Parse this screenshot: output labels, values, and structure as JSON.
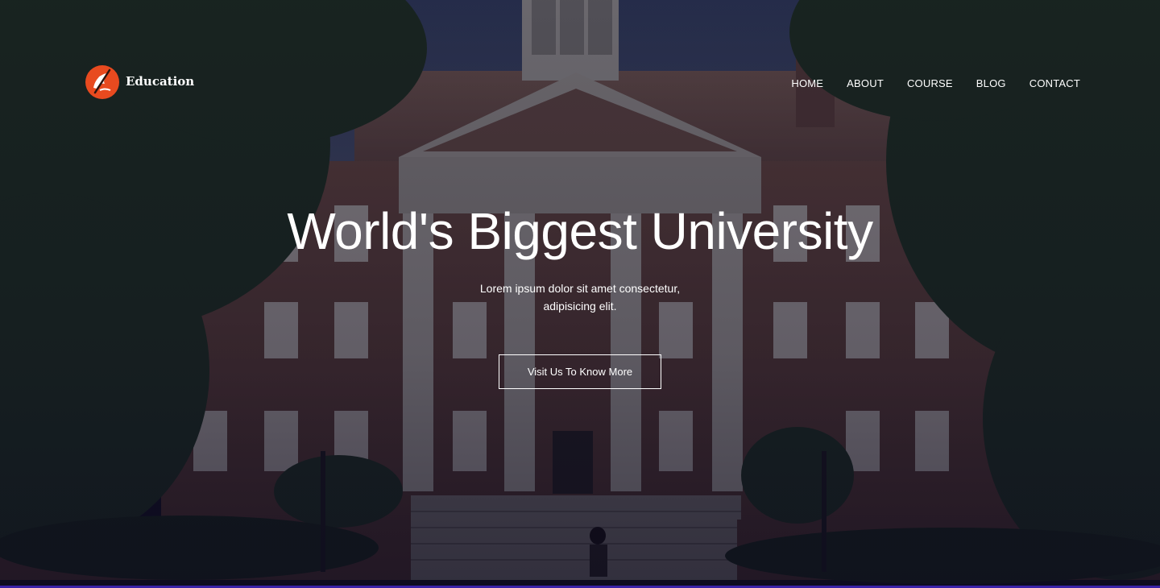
{
  "brand": {
    "name": "Education",
    "logo_icon": "education-logo-icon",
    "logo_color": "#e84a1f"
  },
  "nav": {
    "items": [
      {
        "label": "HOME"
      },
      {
        "label": "ABOUT"
      },
      {
        "label": "COURSE"
      },
      {
        "label": "BLOG"
      },
      {
        "label": "CONTACT"
      }
    ]
  },
  "hero": {
    "title": "World's Biggest University",
    "subtitle": "Lorem ipsum dolor sit amet consectetur, adipisicing elit.",
    "cta_label": "Visit Us To Know More",
    "background": "university-building-photo"
  },
  "colors": {
    "overlay": "#0a081e",
    "accent_line": "#3a22a8",
    "text": "#ffffff"
  }
}
